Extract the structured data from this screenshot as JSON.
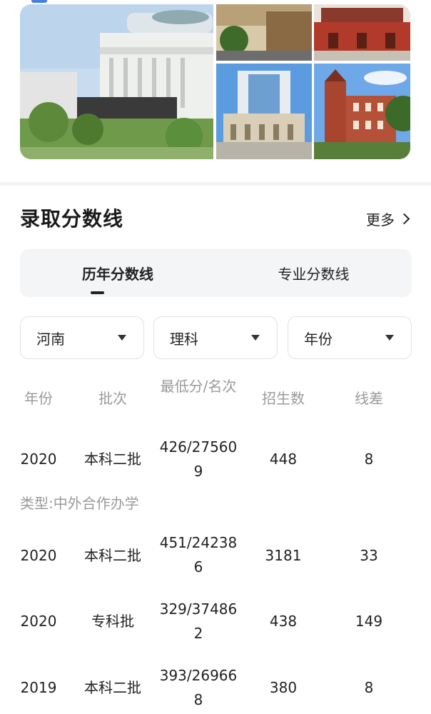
{
  "section": {
    "title": "录取分数线",
    "more_label": "更多"
  },
  "tabs": [
    {
      "label": "历年分数线",
      "active": true
    },
    {
      "label": "专业分数线",
      "active": false
    }
  ],
  "filters": [
    {
      "value": "河南"
    },
    {
      "value": "理科"
    },
    {
      "value": "年份"
    }
  ],
  "table": {
    "headers": [
      "年份",
      "批次",
      "最低分/名次",
      "招生数",
      "线差"
    ],
    "rows": [
      {
        "year": "2020",
        "batch": "本科二批",
        "min_rank": "426/275609",
        "enroll": "448",
        "diff": "8"
      },
      {
        "year": "2020",
        "batch": "本科二批",
        "min_rank": "451/242386",
        "enroll": "3181",
        "diff": "33"
      },
      {
        "year": "2020",
        "batch": "专科批",
        "min_rank": "329/374862",
        "enroll": "438",
        "diff": "149"
      },
      {
        "year": "2019",
        "batch": "本科二批",
        "min_rank": "393/269668",
        "enroll": "380",
        "diff": "8"
      }
    ],
    "type_note": "类型:中外合作办学"
  },
  "colors": {
    "accent": "#4a7de0",
    "muted_text": "#9a9a9e",
    "tab_bg": "#f4f5f7"
  }
}
